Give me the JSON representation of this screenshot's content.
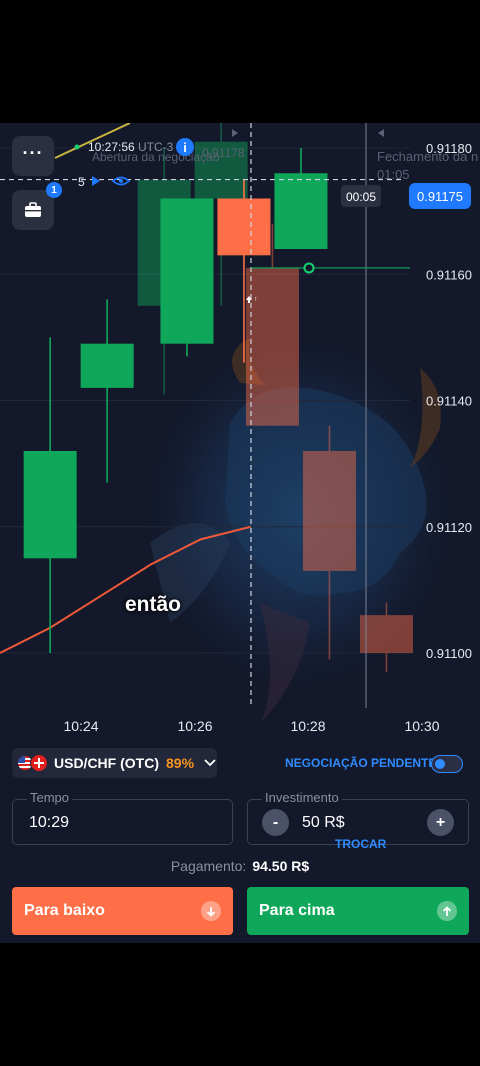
{
  "colors": {
    "bg": "#13182a",
    "bull": "#0fa85a",
    "bear": "#ff6f47",
    "accent": "#1f7aff",
    "payout_pct": "#f7941d"
  },
  "chart_header": {
    "server_time": "10:27:56",
    "utc_label": "UTC-3",
    "opening_label": "Abertura da negociação",
    "opening_price_ghost": "0.91178",
    "closing_label": "Fechamento da n",
    "closing_time": "01:05",
    "watchers_count": "5"
  },
  "toolbar": {
    "menu_icon": "more-dots-icon",
    "portfolio_icon": "briefcase-icon",
    "portfolio_badge": "1",
    "info_icon": "info-icon"
  },
  "price_tag": {
    "countdown": "00:05",
    "current_price": "0.91175"
  },
  "caption": "então",
  "chart_data": {
    "type": "candlestick",
    "y_ticks": [
      "0.91180",
      "0.91160",
      "0.91140",
      "0.91120",
      "0.91100"
    ],
    "x_ticks": [
      "10:24",
      "10:26",
      "10:28",
      "10:30"
    ],
    "ylim": [
      0.9109,
      0.91188
    ],
    "current_price": 0.91175,
    "candles": [
      {
        "x": 0.45,
        "open": 0.91115,
        "close": 0.91132,
        "high": 0.9115,
        "low": 0.911,
        "dir": "up",
        "faded": false
      },
      {
        "x": 1.45,
        "open": 0.91142,
        "close": 0.91149,
        "high": 0.91156,
        "low": 0.91127,
        "dir": "up",
        "faded": false
      },
      {
        "x": 2.45,
        "open": 0.91155,
        "close": 0.91175,
        "high": 0.9118,
        "low": 0.91141,
        "dir": "up",
        "faded": true
      },
      {
        "x": 2.85,
        "open": 0.91149,
        "close": 0.91172,
        "high": 0.91172,
        "low": 0.91147,
        "dir": "up",
        "faded": false
      },
      {
        "x": 3.45,
        "open": 0.91172,
        "close": 0.91181,
        "high": 0.91188,
        "low": 0.91155,
        "dir": "up",
        "faded": true
      },
      {
        "x": 3.85,
        "open": 0.91172,
        "close": 0.91163,
        "high": 0.91175,
        "low": 0.91146,
        "dir": "down",
        "faded": false
      },
      {
        "x": 4.35,
        "open": 0.91161,
        "close": 0.91136,
        "high": 0.91168,
        "low": 0.91136,
        "dir": "down",
        "faded": true
      },
      {
        "x": 4.85,
        "open": 0.91164,
        "close": 0.91176,
        "high": 0.9118,
        "low": 0.91164,
        "dir": "up",
        "faded": false
      },
      {
        "x": 5.35,
        "open": 0.91132,
        "close": 0.91113,
        "high": 0.91136,
        "low": 0.91099,
        "dir": "down",
        "faded": true
      },
      {
        "x": 6.35,
        "open": 0.91106,
        "close": 0.911,
        "high": 0.91108,
        "low": 0.91097,
        "dir": "down",
        "faded": true
      }
    ],
    "moving_average": [
      {
        "x": 0.0,
        "y": 0.911
      },
      {
        "x": 1.0,
        "y": 0.91104
      },
      {
        "x": 2.0,
        "y": 0.91109
      },
      {
        "x": 3.0,
        "y": 0.91114
      },
      {
        "x": 4.0,
        "y": 0.91118
      },
      {
        "x": 5.0,
        "y": 0.9112
      }
    ]
  },
  "asset": {
    "pair": "USD/CHF (OTC)",
    "payout": "89%",
    "chevron_icon": "chevron-down-icon"
  },
  "pending": {
    "label": "NEGOCIAÇÃO PENDENTE"
  },
  "time_field": {
    "label": "Tempo",
    "value": "10:29"
  },
  "investment_field": {
    "label": "Investimento",
    "value": "50 R$",
    "minus": "-",
    "plus": "+"
  },
  "swap_label": "TROCAR",
  "payout": {
    "label": "Pagamento:",
    "value": "94.50 R$"
  },
  "buttons": {
    "down_label": "Para baixo",
    "up_label": "Para cima"
  }
}
